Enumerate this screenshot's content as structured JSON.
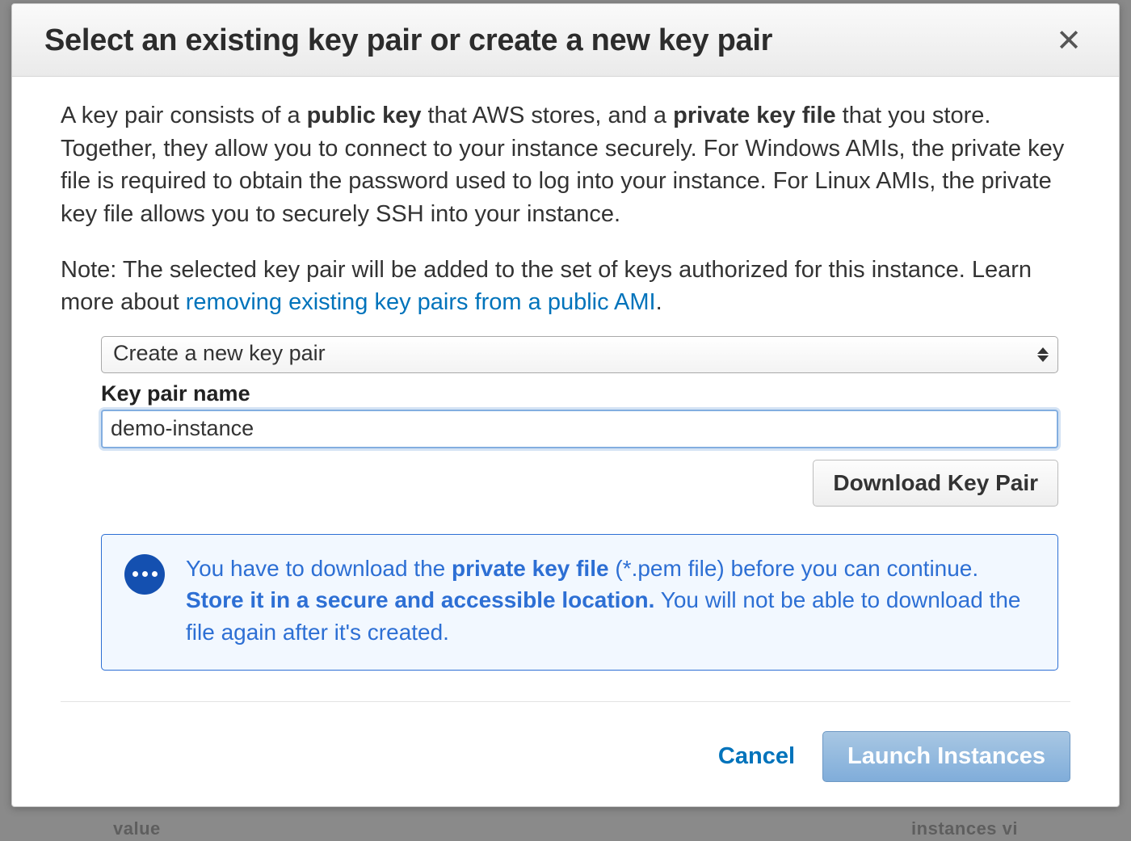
{
  "modal": {
    "title": "Select an existing key pair or create a new key pair",
    "close_symbol": "✕"
  },
  "description": {
    "part1": "A key pair consists of a ",
    "bold1": "public key",
    "part2": " that AWS stores, and a ",
    "bold2": "private key file",
    "part3": " that you store. Together, they allow you to connect to your instance securely. For Windows AMIs, the private key file is required to obtain the password used to log into your instance. For Linux AMIs, the private key file allows you to securely SSH into your instance."
  },
  "note": {
    "prefix": "Note: The selected key pair will be added to the set of keys authorized for this instance. Learn more about ",
    "link_text": "removing existing key pairs from a public AMI",
    "suffix": "."
  },
  "form": {
    "select_value": "Create a new key pair",
    "keypair_label": "Key pair name",
    "keypair_value": "demo-instance",
    "download_button": "Download Key Pair"
  },
  "info": {
    "p1": "You have to download the ",
    "b1": "private key file",
    "p2": " (*.pem file) before you can continue. ",
    "b2": "Store it in a secure and accessible location.",
    "p3": " You will not be able to download the file again after it's created."
  },
  "footer": {
    "cancel": "Cancel",
    "launch": "Launch Instances"
  },
  "background": {
    "left_frag": "value",
    "right_frag": "instances     vi"
  }
}
